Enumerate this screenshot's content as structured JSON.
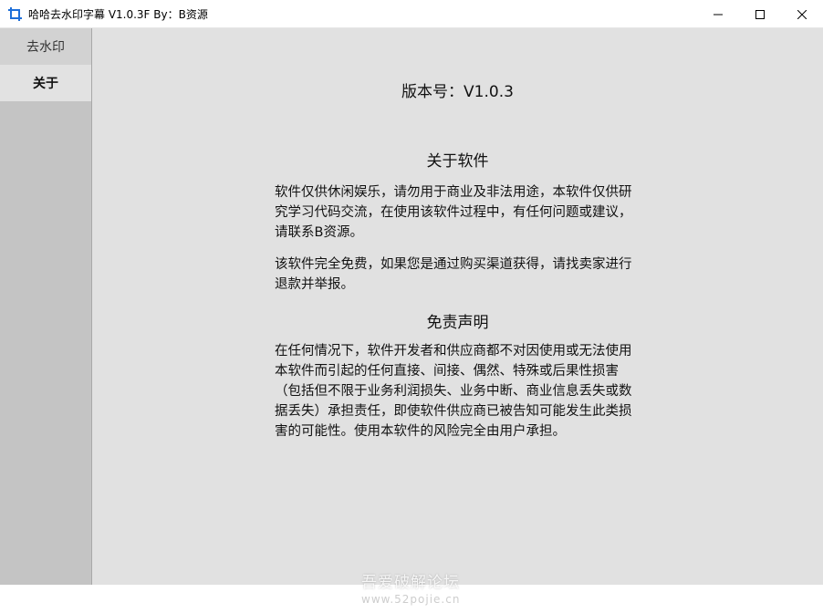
{
  "window": {
    "title": "哈哈去水印字幕 V1.0.3F  By：B资源",
    "icon": "crop-icon",
    "controls": [
      "minimize-icon",
      "maximize-icon",
      "close-icon"
    ]
  },
  "sidebar": {
    "items": [
      {
        "label": "去水印",
        "selected": false
      },
      {
        "label": "关于",
        "selected": true
      }
    ]
  },
  "about": {
    "version": "版本号：V1.0.3",
    "about_title": "关于软件",
    "para1": "软件仅供休闲娱乐，请勿用于商业及非法用途，本软件仅供研究学习代码交流，在使用该软件过程中，有任何问题或建议，请联系B资源。",
    "para2": "该软件完全免费，如果您是通过购买渠道获得，请找卖家进行退款并举报。",
    "disclaimer_title": "免责声明",
    "para3": "在任何情况下，软件开发者和供应商都不对因使用或无法使用本软件而引起的任何直接、间接、偶然、特殊或后果性损害（包括但不限于业务利润损失、业务中断、商业信息丢失或数据丢失）承担责任，即使软件供应商已被告知可能发生此类损害的可能性。使用本软件的风险完全由用户承担。"
  },
  "watermark": {
    "logo_text": "吾爱破解论坛",
    "url": "www.52pojie.cn"
  },
  "colors": {
    "sidebar_bg": "#c4c4c4",
    "content_bg": "#e1e1e1",
    "selected_item_bg": "#e2e2e2",
    "icon_accent": "#1e6fd9"
  }
}
